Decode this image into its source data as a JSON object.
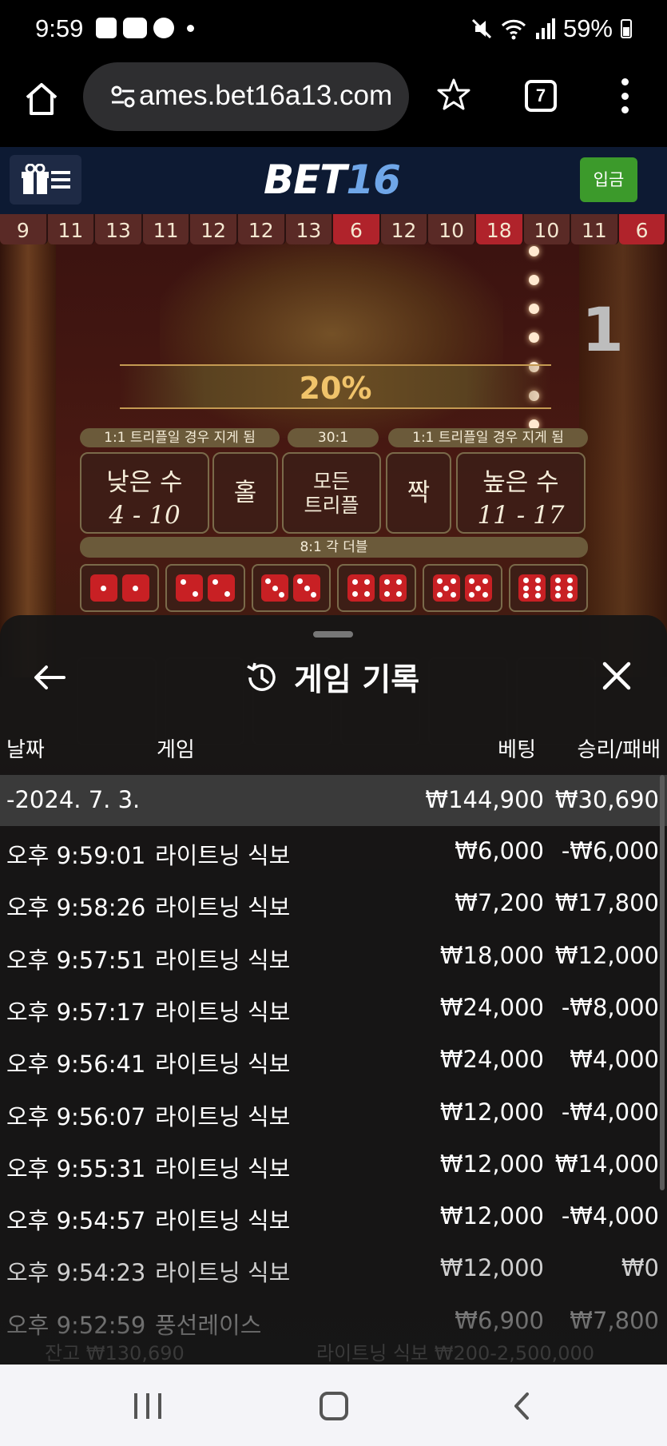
{
  "status_bar": {
    "time": "9:59",
    "battery": "59%",
    "left_icons": [
      "gallery-icon",
      "youtube-icon",
      "chat-bubble-icon",
      "dot-icon"
    ],
    "right_icons": [
      "mute-icon",
      "wifi-icon",
      "signal-icon",
      "battery-icon"
    ]
  },
  "browser": {
    "url": "ames.bet16a13.com",
    "tab_count": "7"
  },
  "site": {
    "logo_part1": "BET",
    "logo_part2": "16",
    "deposit_label": "입금"
  },
  "game": {
    "history": [
      {
        "n": "9",
        "red": false
      },
      {
        "n": "11",
        "red": false
      },
      {
        "n": "13",
        "red": false
      },
      {
        "n": "11",
        "red": false
      },
      {
        "n": "12",
        "red": false
      },
      {
        "n": "12",
        "red": false
      },
      {
        "n": "13",
        "red": false
      },
      {
        "n": "6",
        "red": true
      },
      {
        "n": "12",
        "red": false
      },
      {
        "n": "10",
        "red": false
      },
      {
        "n": "18",
        "red": true
      },
      {
        "n": "10",
        "red": false
      },
      {
        "n": "11",
        "red": false
      },
      {
        "n": "6",
        "red": true
      }
    ],
    "side_number": "1",
    "multiplier": "20%",
    "odds_left": "1:1 트리플일 경우 지게 됨",
    "odds_mid": "30:1",
    "odds_right": "1:1 트리플일 경우 지게 됨",
    "low_label": "낮은 수",
    "low_range": "4 - 10",
    "odd_label": "홀",
    "triple_label_1": "모든",
    "triple_label_2": "트리플",
    "even_label": "짝",
    "high_label": "높은 수",
    "high_range": "11 - 17",
    "double_label": "8:1 각 더블",
    "dice_pairs": [
      1,
      2,
      3,
      4,
      5,
      6
    ]
  },
  "sheet": {
    "title": "게임 기록",
    "columns": {
      "date": "날짜",
      "game": "게임",
      "bet": "베팅",
      "result": "승리/패배"
    },
    "total": {
      "date": "-2024. 7. 3.",
      "bet": "₩144,900",
      "result": "₩30,690"
    },
    "rows": [
      {
        "time": "오후 9:59:01",
        "game": "라이트닝 식보",
        "bet": "₩6,000",
        "result": "-₩6,000"
      },
      {
        "time": "오후 9:58:26",
        "game": "라이트닝 식보",
        "bet": "₩7,200",
        "result": "₩17,800"
      },
      {
        "time": "오후 9:57:51",
        "game": "라이트닝 식보",
        "bet": "₩18,000",
        "result": "₩12,000"
      },
      {
        "time": "오후 9:57:17",
        "game": "라이트닝 식보",
        "bet": "₩24,000",
        "result": "-₩8,000"
      },
      {
        "time": "오후 9:56:41",
        "game": "라이트닝 식보",
        "bet": "₩24,000",
        "result": "₩4,000"
      },
      {
        "time": "오후 9:56:07",
        "game": "라이트닝 식보",
        "bet": "₩12,000",
        "result": "-₩4,000"
      },
      {
        "time": "오후 9:55:31",
        "game": "라이트닝 식보",
        "bet": "₩12,000",
        "result": "₩14,000"
      },
      {
        "time": "오후 9:54:57",
        "game": "라이트닝 식보",
        "bet": "₩12,000",
        "result": "-₩4,000"
      },
      {
        "time": "오후 9:54:23",
        "game": "라이트닝 식보",
        "bet": "₩12,000",
        "result": "₩0"
      },
      {
        "time": "오후 9:52:59",
        "game": "풍선레이스",
        "bet": "₩6,900",
        "result": "₩7,800"
      }
    ]
  },
  "footer_ghost": {
    "balance": "잔고 ₩130,690",
    "limits": "라이트닝 식보 ₩200-2,500,000"
  }
}
